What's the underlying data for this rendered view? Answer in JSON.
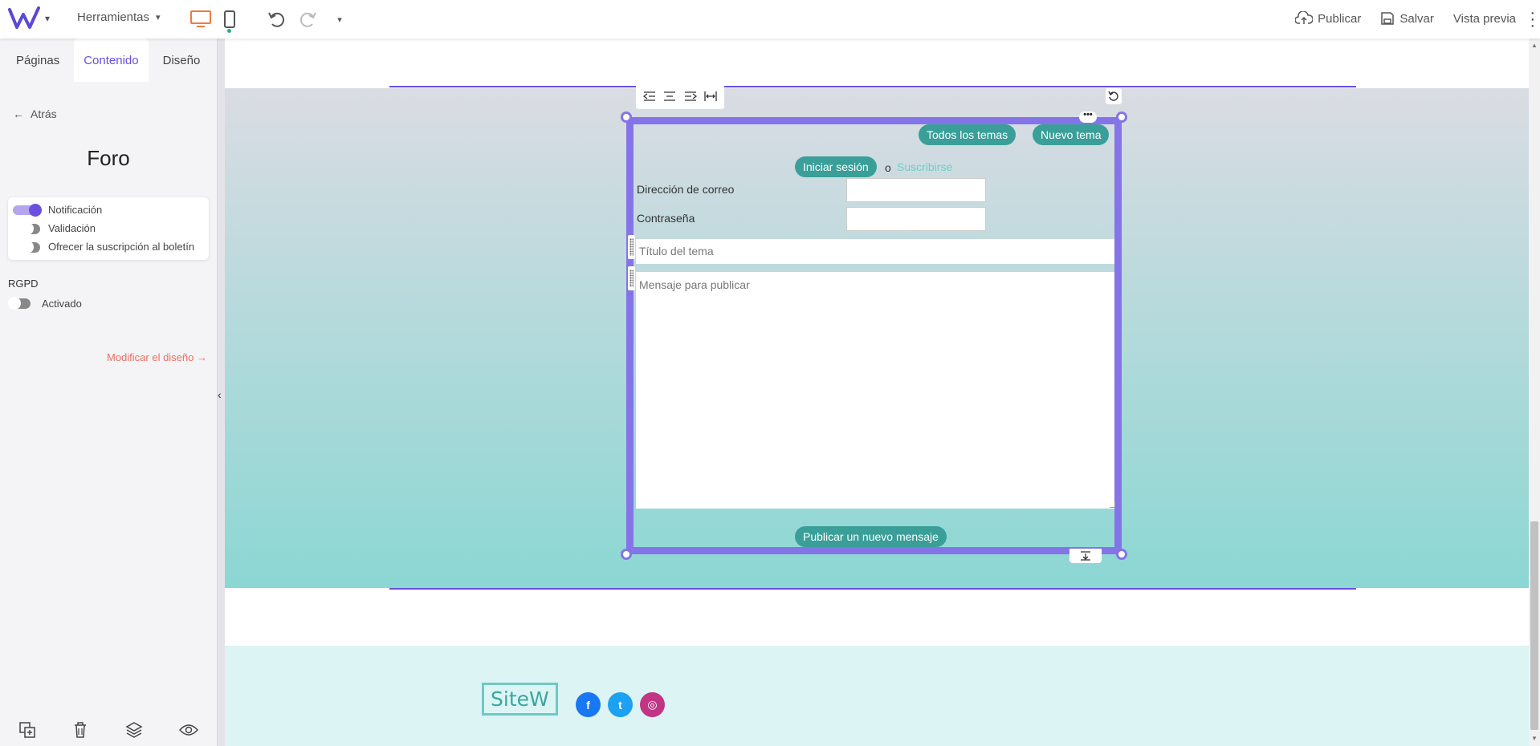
{
  "topbar": {
    "tools_label": "Herramientas",
    "publish_label": "Publicar",
    "save_label": "Salvar",
    "preview_label": "Vista previa",
    "icons": [
      "logo-w-icon",
      "chevron-down-icon",
      "desktop-icon",
      "mobile-icon",
      "undo-icon",
      "redo-icon",
      "upload-icon",
      "save-icon",
      "kebab-icon"
    ],
    "accent_color": "#ef7b3e"
  },
  "sidebar": {
    "tabs": [
      {
        "label": "Páginas"
      },
      {
        "label": "Contenido"
      },
      {
        "label": "Diseño"
      }
    ],
    "back_label": "Atrás",
    "title": "Foro",
    "options": [
      {
        "label": "Notificación",
        "enabled": true
      },
      {
        "label": "Validación",
        "enabled": false
      },
      {
        "label": "Ofrecer la suscripción al boletín",
        "enabled": false
      }
    ],
    "rgpd_title": "RGPD",
    "rgpd_option": {
      "label": "Activado",
      "enabled": false
    },
    "modify_design_label": "Modificar el diseño",
    "accent_color": "#6a4fe0"
  },
  "forum": {
    "all_topics_label": "Todos los temas",
    "new_topic_label": "Nuevo tema",
    "login_label": "Iniciar sesión",
    "or_label": "o",
    "subscribe_label": "Suscribirse",
    "email_label": "Dirección de correo",
    "password_label": "Contraseña",
    "topic_title_placeholder": "Título del tema",
    "message_placeholder": "Mensaje para publicar",
    "publish_message_label": "Publicar un nuevo mensaje",
    "button_color": "#3a9f98",
    "selection_color": "#8574e8"
  },
  "footer": {
    "logo_text": "SiteW",
    "social": [
      {
        "name": "facebook-icon",
        "glyph": "f",
        "color": "#1877f2"
      },
      {
        "name": "twitter-icon",
        "glyph": "t",
        "color": "#1da1f2"
      },
      {
        "name": "instagram-icon",
        "glyph": "◎",
        "color": "#c13584"
      }
    ]
  }
}
